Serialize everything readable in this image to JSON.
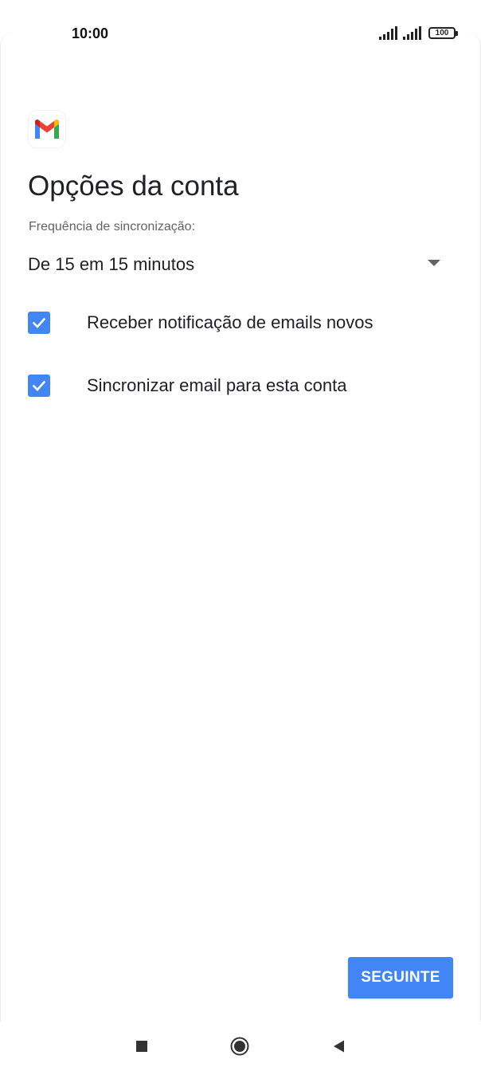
{
  "status_bar": {
    "time": "10:00",
    "battery": "100"
  },
  "app": {
    "logo_icon": "gmail-logo",
    "colors": {
      "accent": "#4285f4",
      "gmail_red": "#ea4335",
      "gmail_blue": "#4285f4",
      "gmail_green": "#34a853",
      "gmail_yellow": "#fbbc04",
      "gmail_dark_red": "#c5221f"
    }
  },
  "page": {
    "title": "Opções da conta",
    "sync_frequency_label": "Frequência de sincronização:",
    "sync_frequency_value": "De 15 em 15 minutos",
    "options": [
      {
        "label": "Receber notificação de emails novos",
        "checked": true
      },
      {
        "label": "Sincronizar email para esta conta",
        "checked": true
      }
    ],
    "next_button": "SEGUINTE"
  },
  "nav_bar": {
    "recents_icon": "square-icon",
    "home_icon": "circle-icon",
    "back_icon": "triangle-back-icon"
  }
}
